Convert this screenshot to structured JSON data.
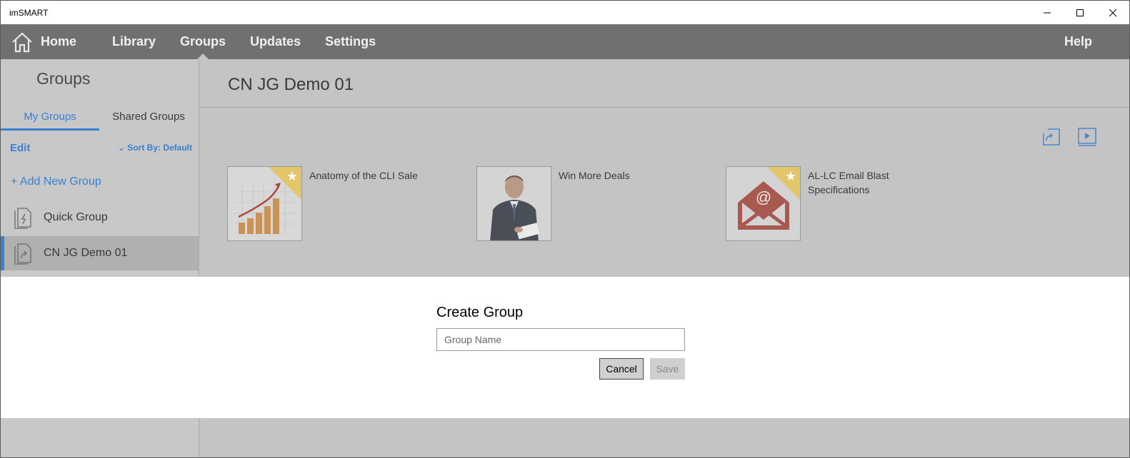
{
  "app": {
    "title": "imSMART"
  },
  "window_controls": {
    "minimize_icon": "minimize-icon",
    "maximize_icon": "maximize-icon",
    "close_icon": "close-icon"
  },
  "nav": {
    "home_icon": "home-icon",
    "items": [
      {
        "label": "Home"
      },
      {
        "label": "Library"
      },
      {
        "label": "Groups",
        "active": true
      },
      {
        "label": "Updates"
      },
      {
        "label": "Settings"
      }
    ],
    "help_label": "Help"
  },
  "sidebar": {
    "title": "Groups",
    "tabs": [
      {
        "label": "My Groups",
        "active": true
      },
      {
        "label": "Shared Groups"
      }
    ],
    "edit_label": "Edit",
    "sort_label": "Sort By:",
    "sort_value": "Default",
    "add_group_label": "+ Add New Group",
    "groups": [
      {
        "label": "Quick Group",
        "icon": "quick-group-icon"
      },
      {
        "label": "CN JG Demo 01",
        "icon": "shared-group-icon",
        "selected": true
      }
    ]
  },
  "main": {
    "title": "CN JG Demo 01",
    "toolbar_icons": [
      "present-icon",
      "play-icon"
    ],
    "items": [
      {
        "label": "Anatomy of the CLI Sale",
        "favorite": true,
        "thumb": "chart-thumbnail"
      },
      {
        "label": "Win More Deals",
        "favorite": false,
        "thumb": "businessman-thumbnail"
      },
      {
        "label": "AL-LC Email Blast Specifications",
        "favorite": true,
        "thumb": "email-thumbnail"
      }
    ]
  },
  "dialog": {
    "title": "Create Group",
    "input_placeholder": "Group Name",
    "input_value": "",
    "cancel_label": "Cancel",
    "save_label": "Save"
  },
  "colors": {
    "accent": "#3a7fd0",
    "nav_bg": "#707070",
    "favorite": "#e3c66a"
  }
}
